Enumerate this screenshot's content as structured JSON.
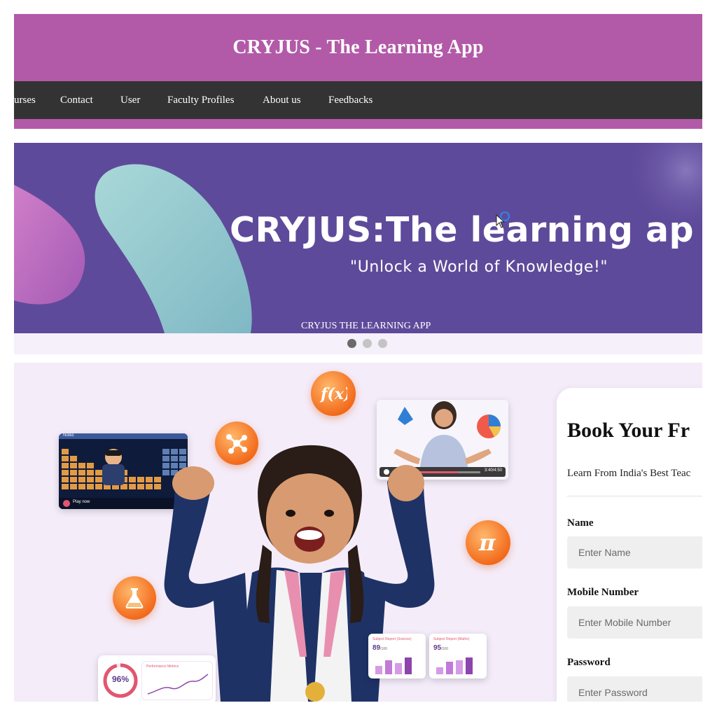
{
  "header": {
    "title": "CRYJUS - The Learning App"
  },
  "nav": {
    "items": [
      {
        "label": "urses"
      },
      {
        "label": "Contact"
      },
      {
        "label": "User"
      },
      {
        "label": "Faculty Profiles"
      },
      {
        "label": "About us"
      },
      {
        "label": "Feedbacks"
      }
    ]
  },
  "banner": {
    "headline": "CRYJUS:The learning ap",
    "tagline": "\"Unlock a World of Knowledge!\"",
    "caption": "CRYJUS THE LEARNING APP",
    "slide_count": 3,
    "active_slide": 1
  },
  "hero": {
    "video_card_left": {
      "label": "Play now",
      "tag": "Notes"
    },
    "video_card_right": {
      "time": "3:40/4:50"
    },
    "performance_card": {
      "percent": "96%",
      "label": "Performance Metrics"
    },
    "report_cards": [
      {
        "title": "Subject Report (Science)",
        "score": "89",
        "total": "/100"
      },
      {
        "title": "Subject Report (Maths)",
        "score": "95",
        "total": "/100"
      }
    ],
    "icons": [
      "function-icon",
      "molecule-icon",
      "pi-icon",
      "flask-icon"
    ]
  },
  "form": {
    "title": "Book Your Fr",
    "subtitle": "Learn From India's Best Teac",
    "fields": [
      {
        "label": "Name",
        "placeholder": "Enter Name"
      },
      {
        "label": "Mobile Number",
        "placeholder": "Enter Mobile Number"
      },
      {
        "label": "Password",
        "placeholder": "Enter Password"
      }
    ]
  },
  "colors": {
    "brand_pink": "#b25aa8",
    "nav_dark": "#333333",
    "banner_purple": "#5e4a9a",
    "hero_bg": "#f4ecf9",
    "icon_orange": "#f36b1c"
  }
}
